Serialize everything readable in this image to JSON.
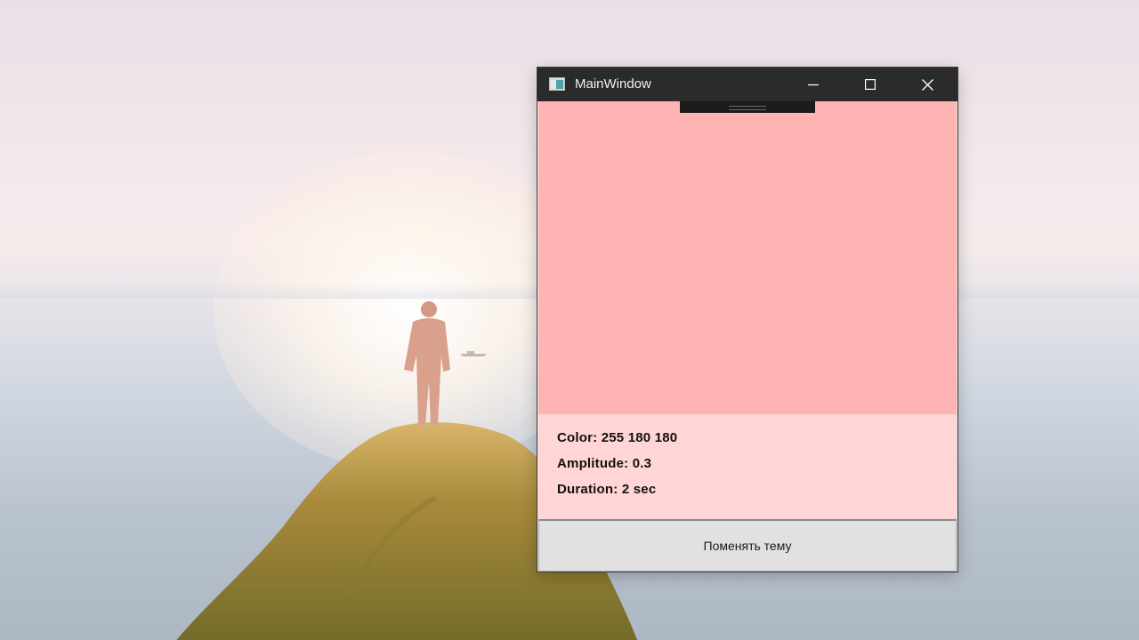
{
  "window": {
    "title": "MainWindow",
    "icon": "app-window-icon",
    "controls": [
      "minimize-icon",
      "maximize-icon",
      "close-icon"
    ]
  },
  "preview": {
    "color_hex": "#ffb4b4",
    "panel_hex": "#ffd5d5"
  },
  "info": {
    "color": "Color: 255 180 180",
    "amplitude": "Amplitude: 0.3",
    "duration": "Duration: 2 sec"
  },
  "actions": {
    "change_theme_label": "Поменять тему"
  }
}
